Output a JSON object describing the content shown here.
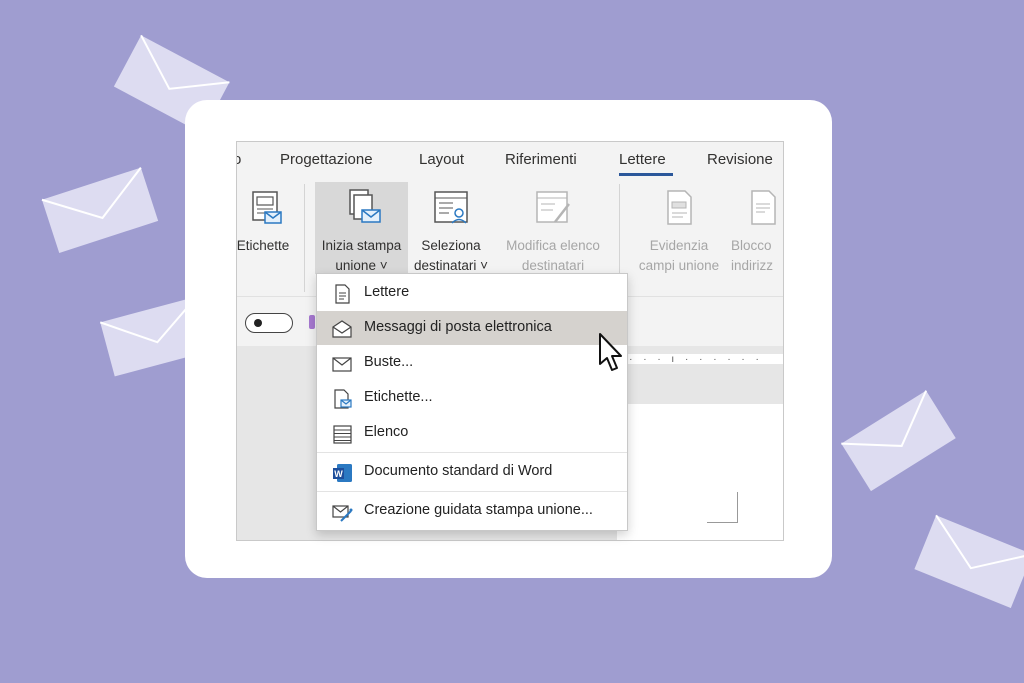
{
  "colors": {
    "background": "#9f9dd0",
    "card": "#ffffff",
    "accent": "#2b579a",
    "highlight": "#d5d2ce"
  },
  "tabs": [
    {
      "label": "o"
    },
    {
      "label": "Progettazione"
    },
    {
      "label": "Layout"
    },
    {
      "label": "Riferimenti"
    },
    {
      "label": "Lettere"
    },
    {
      "label": "Revisione"
    }
  ],
  "ribbon": {
    "etichette": {
      "label": "Etichette",
      "icon": "labels-icon"
    },
    "inizia": {
      "line1": "Inizia stampa",
      "line2": "unione ˅",
      "icon": "start-mail-merge-icon"
    },
    "seleziona": {
      "line1": "Seleziona",
      "line2": "destinatari ˅",
      "icon": "select-recipients-icon"
    },
    "modifica": {
      "line1": "Modifica elenco",
      "line2": "destinatari",
      "icon": "edit-recipient-list-icon"
    },
    "evidenzia": {
      "line1": "Evidenzia",
      "line2": "campi unione",
      "icon": "highlight-merge-fields-icon"
    },
    "blocco": {
      "line1": "Blocco",
      "line2": "indirizz",
      "icon": "address-block-icon"
    }
  },
  "menu": {
    "items": [
      {
        "label": "Lettere",
        "icon": "letter-document-icon"
      },
      {
        "label": "Messaggi di posta elettronica",
        "icon": "open-envelope-icon"
      },
      {
        "label": "Buste...",
        "icon": "envelope-icon"
      },
      {
        "label": "Etichette...",
        "icon": "label-document-icon"
      },
      {
        "label": "Elenco",
        "icon": "directory-list-icon"
      },
      {
        "label": "Documento standard di Word",
        "icon": "word-logo-icon"
      },
      {
        "label": "Creazione guidata stampa unione...",
        "icon": "mail-merge-wizard-icon"
      }
    ]
  },
  "ruler": {
    "ticks": "· · · · ı · · · ·   · ·"
  }
}
